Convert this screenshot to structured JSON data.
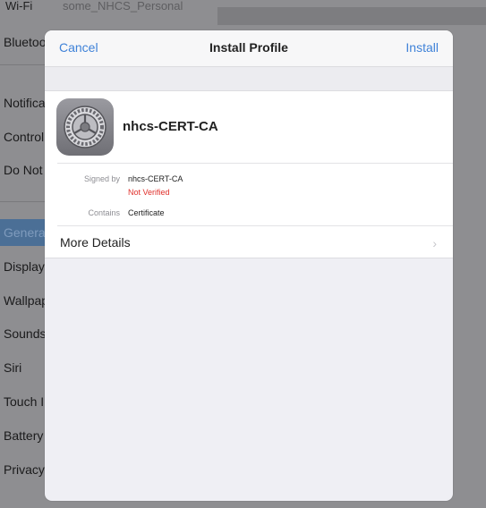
{
  "background": {
    "top_label": "Wi-Fi",
    "top_detail": "some_NHCS_Personal",
    "items": [
      {
        "label": "Bluetooth"
      },
      {
        "label": "Notifications"
      },
      {
        "label": "Control Center"
      },
      {
        "label": "Do Not Disturb"
      },
      {
        "label": "General"
      },
      {
        "label": "Display & Brightness"
      },
      {
        "label": "Wallpaper"
      },
      {
        "label": "Sounds"
      },
      {
        "label": "Siri"
      },
      {
        "label": "Touch ID & Passcode"
      },
      {
        "label": "Battery"
      },
      {
        "label": "Privacy"
      }
    ]
  },
  "modal": {
    "cancel_label": "Cancel",
    "title": "Install Profile",
    "install_label": "Install",
    "profile": {
      "icon": "settings-gear-icon",
      "name": "nhcs-CERT-CA",
      "signed_by_label": "Signed by",
      "signed_by_value": "nhcs-CERT-CA",
      "verification_status": "Not Verified",
      "contains_label": "Contains",
      "contains_value": "Certificate"
    },
    "more_details_label": "More Details",
    "chevron_icon": "chevron-right-icon"
  },
  "colors": {
    "accent": "#3f82d8",
    "warning": "#e0302b",
    "dim_overlay": "#8e8e91",
    "selected_item": "#4b6f96"
  }
}
